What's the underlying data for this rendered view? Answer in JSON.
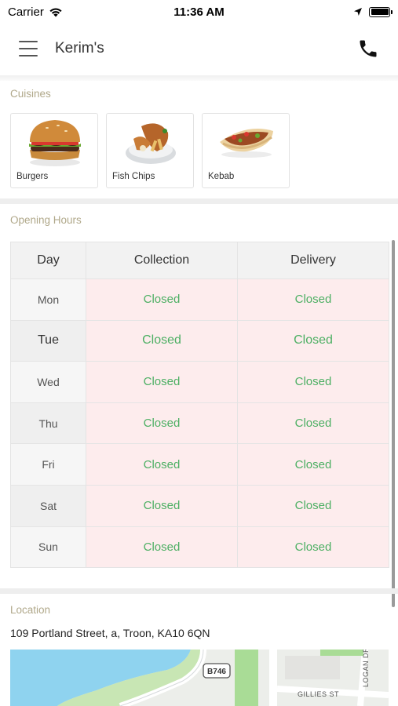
{
  "status_bar": {
    "carrier": "Carrier",
    "time": "11:36 AM"
  },
  "header": {
    "title": "Kerim's"
  },
  "cuisines": {
    "label": "Cuisines",
    "items": [
      {
        "name": "Burgers"
      },
      {
        "name": "Fish  Chips"
      },
      {
        "name": "Kebab"
      }
    ]
  },
  "opening_hours": {
    "label": "Opening Hours",
    "columns": [
      "Day",
      "Collection",
      "Delivery"
    ],
    "rows": [
      {
        "day": "Mon",
        "collection": "Closed",
        "delivery": "Closed"
      },
      {
        "day": "Tue",
        "collection": "Closed",
        "delivery": "Closed"
      },
      {
        "day": "Wed",
        "collection": "Closed",
        "delivery": "Closed"
      },
      {
        "day": "Thu",
        "collection": "Closed",
        "delivery": "Closed"
      },
      {
        "day": "Fri",
        "collection": "Closed",
        "delivery": "Closed"
      },
      {
        "day": "Sat",
        "collection": "Closed",
        "delivery": "Closed"
      },
      {
        "day": "Sun",
        "collection": "Closed",
        "delivery": "Closed"
      }
    ]
  },
  "location": {
    "label": "Location",
    "address": "109 Portland Street, a, Troon, KA10 6QN",
    "map": {
      "road_badge": "B746",
      "street_1": "GILLIES ST",
      "street_2": "LOGAN DR"
    }
  },
  "colors": {
    "section_label": "#b0a88a",
    "closed_text": "#4caf63",
    "closed_bg": "#fdeced"
  }
}
